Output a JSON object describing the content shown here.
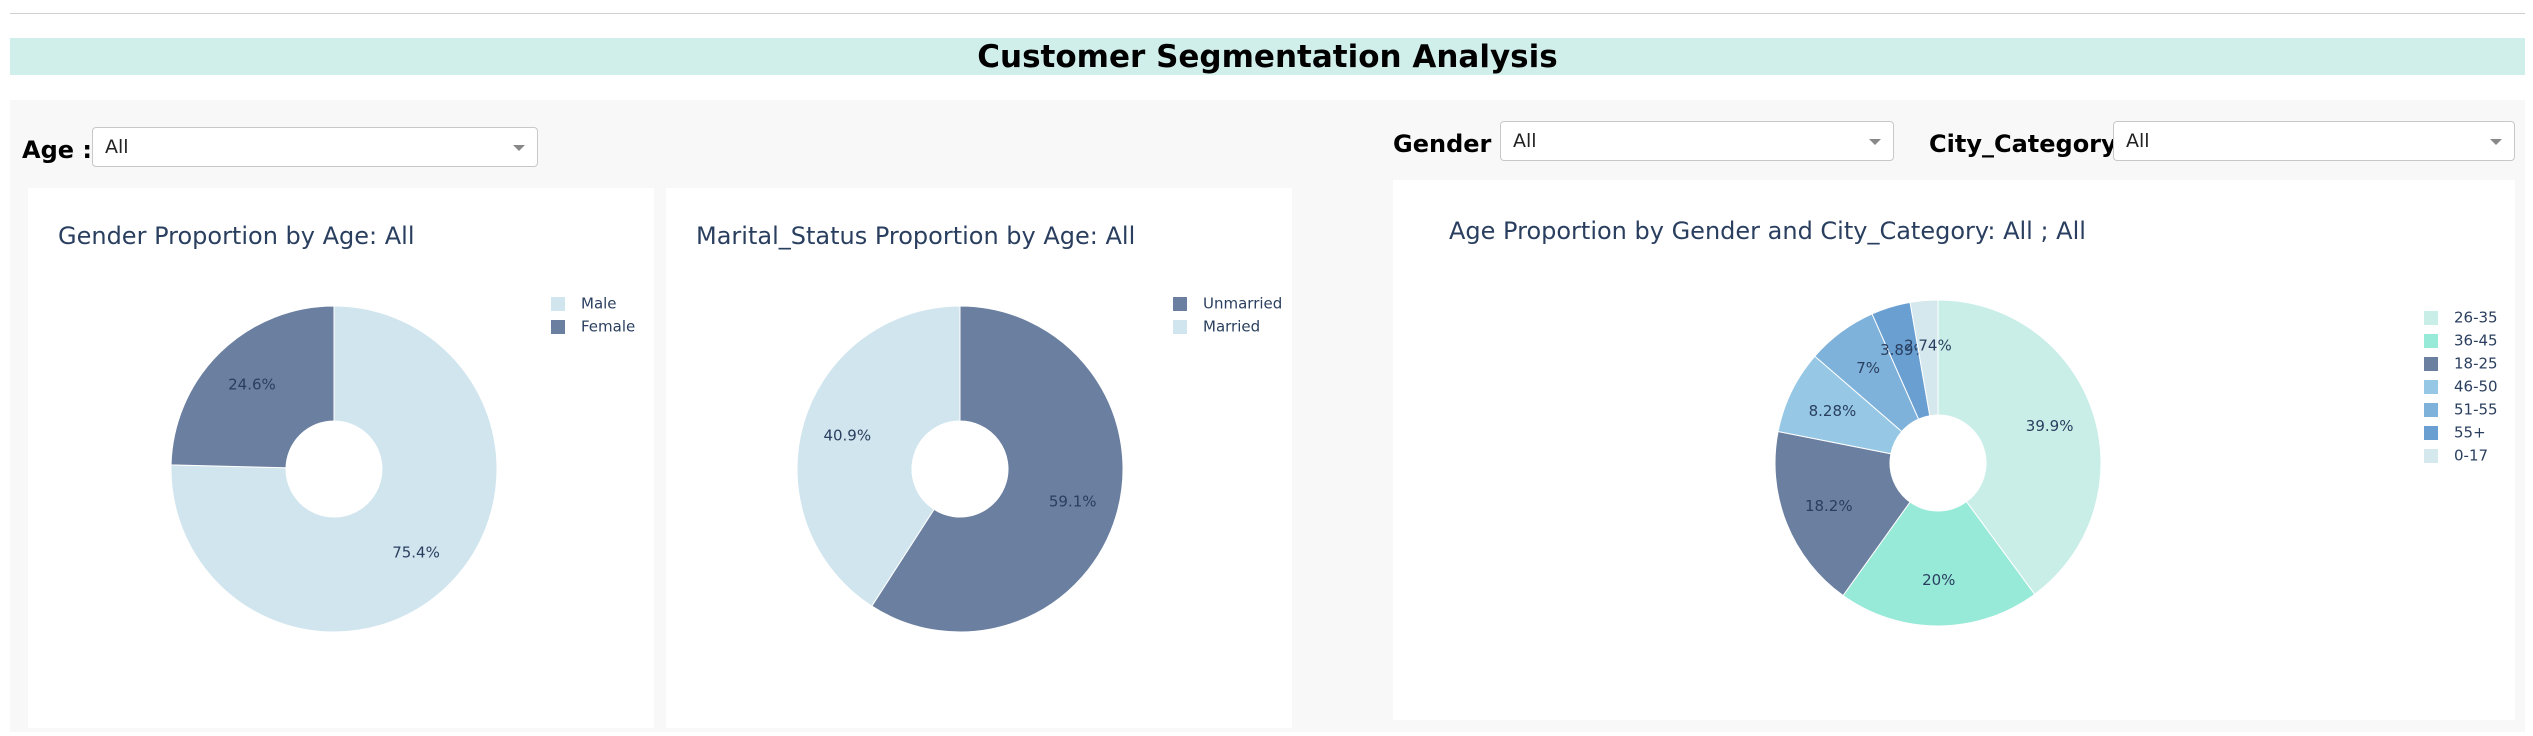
{
  "header": {
    "title": "Customer Segmentation Analysis"
  },
  "filters": {
    "age": {
      "label": "Age :",
      "value": "All"
    },
    "gender": {
      "label": "Gender :",
      "value": "All"
    },
    "city": {
      "label": "City_Category :",
      "value": "All"
    }
  },
  "colors": {
    "light_blue": "#d0e5ee",
    "slate": "#6b7fa0",
    "mint": "#97e9d8",
    "mint_light": "#c9eee8",
    "sky": "#96c8e6",
    "sky_mid": "#7fb2da",
    "sky_dark": "#6a9fd1",
    "pale": "#d4e8ee"
  },
  "chart_data": [
    {
      "type": "pie",
      "hole": true,
      "title": "Gender Proportion by Age: All",
      "labels": [
        "Male",
        "Female"
      ],
      "values": [
        75.4,
        24.6
      ],
      "text": [
        "75.4%",
        "24.6%"
      ],
      "colors": [
        "#d0e5ee",
        "#6b7fa0"
      ],
      "legend": "top-right"
    },
    {
      "type": "pie",
      "hole": true,
      "title": "Marital_Status Proportion by Age: All",
      "labels": [
        "Unmarried",
        "Married"
      ],
      "values": [
        59.1,
        40.9
      ],
      "text": [
        "59.1%",
        "40.9%"
      ],
      "colors": [
        "#6b7fa0",
        "#d0e5ee"
      ],
      "legend": "top-right"
    },
    {
      "type": "pie",
      "hole": true,
      "title": "Age Proportion by Gender and City_Category: All ; All",
      "labels": [
        "26-35",
        "36-45",
        "18-25",
        "46-50",
        "51-55",
        "55+",
        "0-17"
      ],
      "values": [
        39.9,
        20,
        18.2,
        8.28,
        7,
        3.89,
        2.74
      ],
      "text": [
        "39.9%",
        "20%",
        "18.2%",
        "8.28%",
        "7%",
        "3.89%",
        "2.74%"
      ],
      "colors": [
        "#c9eee8",
        "#97e9d8",
        "#6b7fa0",
        "#96c8e6",
        "#7fb2da",
        "#6a9fd1",
        "#d4e8ee"
      ],
      "legend": "top-right"
    }
  ]
}
